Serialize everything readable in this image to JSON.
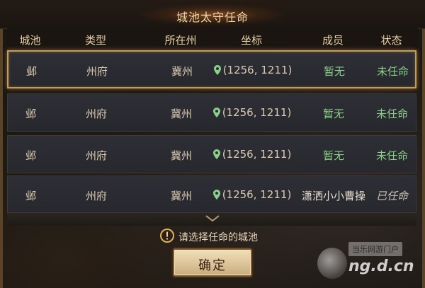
{
  "title": "城池太守任命",
  "columns": [
    "城池",
    "类型",
    "所在州",
    "坐标",
    "成员",
    "状态"
  ],
  "rows": [
    {
      "city": "邺",
      "type": "州府",
      "state": "冀州",
      "coord": "(1256, 1211)",
      "member": "暂无",
      "status": "未任命",
      "selected": true
    },
    {
      "city": "邺",
      "type": "州府",
      "state": "冀州",
      "coord": "(1256, 1211)",
      "member": "暂无",
      "status": "未任命",
      "selected": false
    },
    {
      "city": "邺",
      "type": "州府",
      "state": "冀州",
      "coord": "(1256, 1211)",
      "member": "暂无",
      "status": "未任命",
      "selected": false
    },
    {
      "city": "邺",
      "type": "州府",
      "state": "冀州",
      "coord": "(1256, 1211)",
      "member": "潇洒小小曹操",
      "status": "已任命",
      "selected": false
    }
  ],
  "hint": "请选择任命的城池",
  "confirm_label": "确定",
  "watermark": {
    "top": "当乐网游门户",
    "bottom": "ng.d.cn"
  },
  "icons": {
    "coordinate": "map-pin-icon",
    "hint": "warning-icon",
    "scroll": "chevron-down-icon"
  },
  "colors": {
    "accent_gold": "#c89b55",
    "status_green": "#8bd08a",
    "title_text": "#f3d7a4"
  }
}
